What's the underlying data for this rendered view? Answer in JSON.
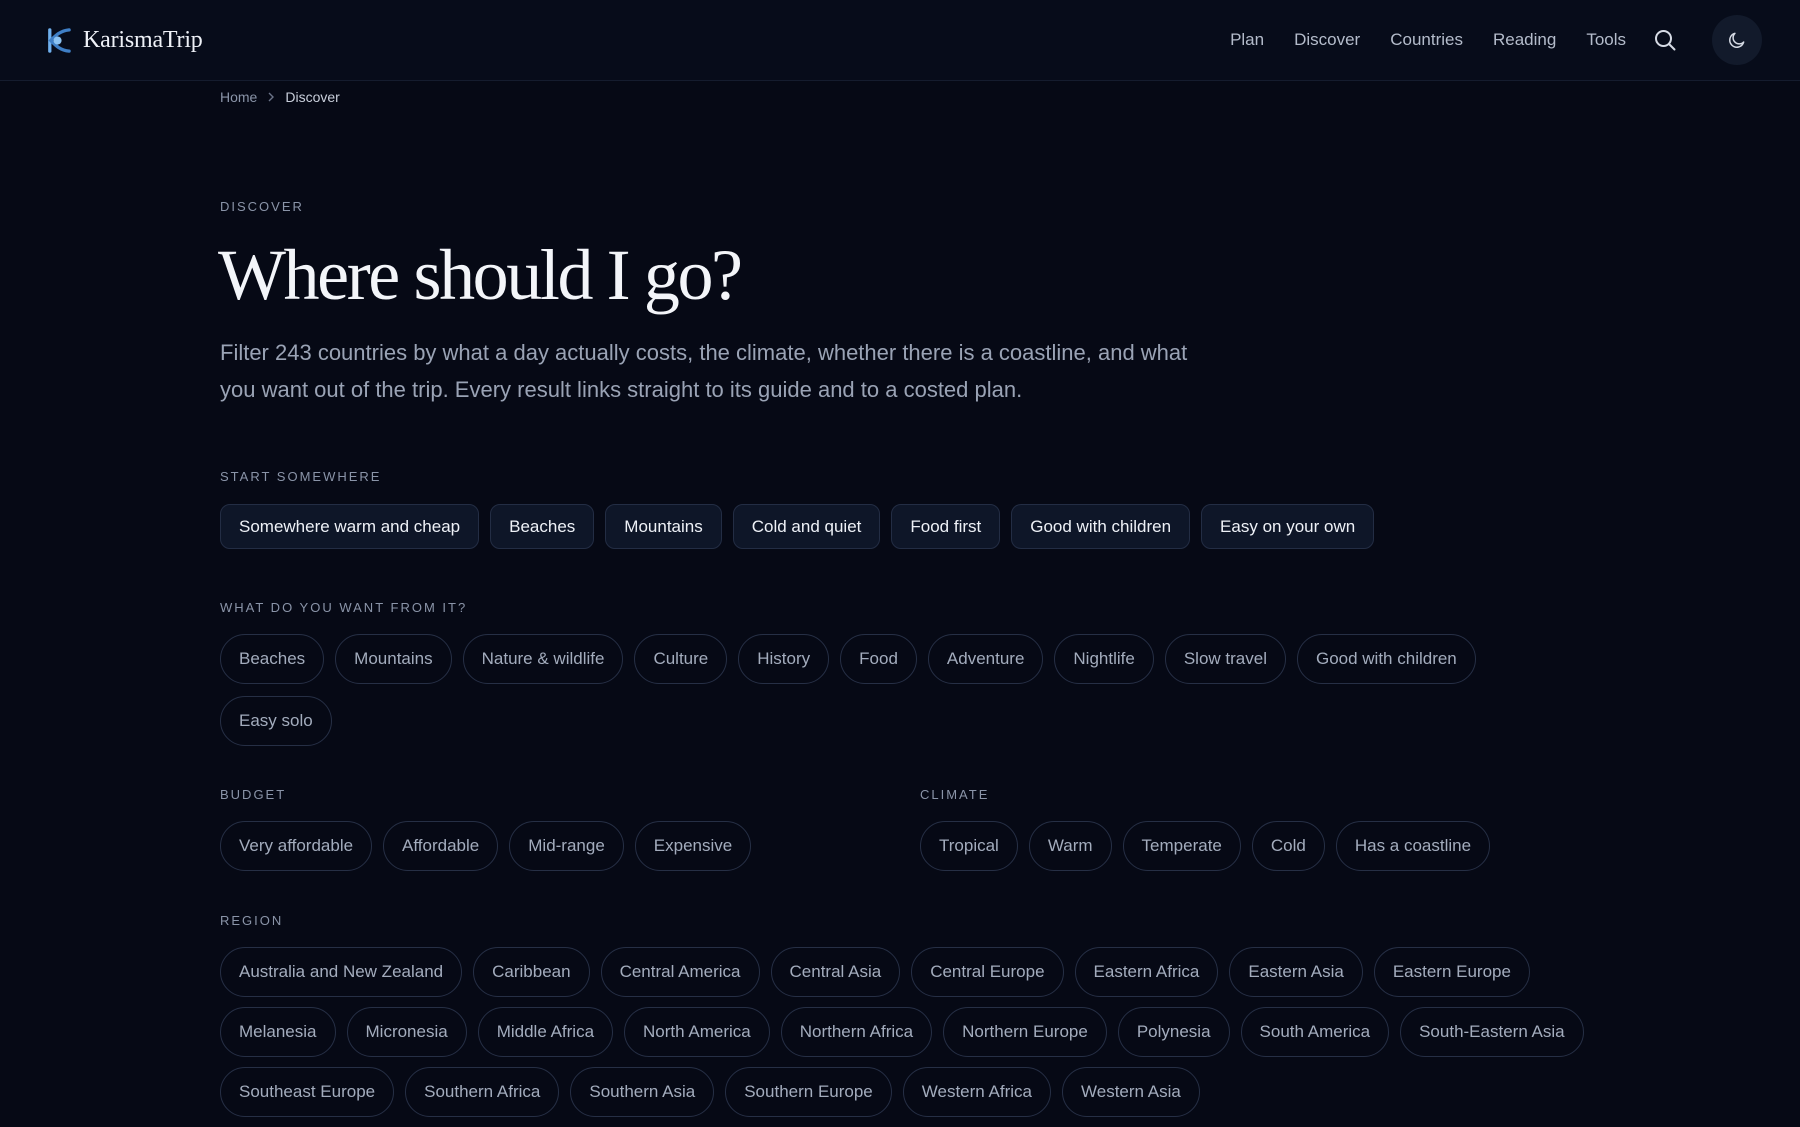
{
  "header": {
    "brand": "KarismaTrip",
    "nav": [
      "Plan",
      "Discover",
      "Countries",
      "Reading",
      "Tools"
    ]
  },
  "breadcrumb": {
    "home": "Home",
    "current": "Discover"
  },
  "hero": {
    "eyebrow": "DISCOVER",
    "title": "Where should I go?",
    "intro": "Filter 243 countries by what a day actually costs, the climate, whether there is a coastline, and what you want out of the trip. Every result links straight to its guide and to a costed plan."
  },
  "start": {
    "label": "START SOMEWHERE",
    "chips": [
      "Somewhere warm and cheap",
      "Beaches",
      "Mountains",
      "Cold and quiet",
      "Food first",
      "Good with children",
      "Easy on your own"
    ]
  },
  "want": {
    "label": "WHAT DO YOU WANT FROM IT?",
    "chips": [
      "Beaches",
      "Mountains",
      "Nature & wildlife",
      "Culture",
      "History",
      "Food",
      "Adventure",
      "Nightlife",
      "Slow travel",
      "Good with children",
      "Easy solo"
    ]
  },
  "budget": {
    "label": "BUDGET",
    "chips": [
      "Very affordable",
      "Affordable",
      "Mid-range",
      "Expensive"
    ]
  },
  "climate": {
    "label": "CLIMATE",
    "chips": [
      "Tropical",
      "Warm",
      "Temperate",
      "Cold",
      "Has a coastline"
    ]
  },
  "region": {
    "label": "REGION",
    "chips": [
      "Australia and New Zealand",
      "Caribbean",
      "Central America",
      "Central Asia",
      "Central Europe",
      "Eastern Africa",
      "Eastern Asia",
      "Eastern Europe",
      "Melanesia",
      "Micronesia",
      "Middle Africa",
      "North America",
      "Northern Africa",
      "Northern Europe",
      "Polynesia",
      "South America",
      "South-Eastern Asia",
      "Southeast Europe",
      "Southern Africa",
      "Southern Asia",
      "Southern Europe",
      "Western Africa",
      "Western Asia"
    ]
  },
  "colors": {
    "background": "#060915",
    "accent": "#4f8fd6",
    "text": "#e6eaf2",
    "muted": "#8a94a8"
  }
}
